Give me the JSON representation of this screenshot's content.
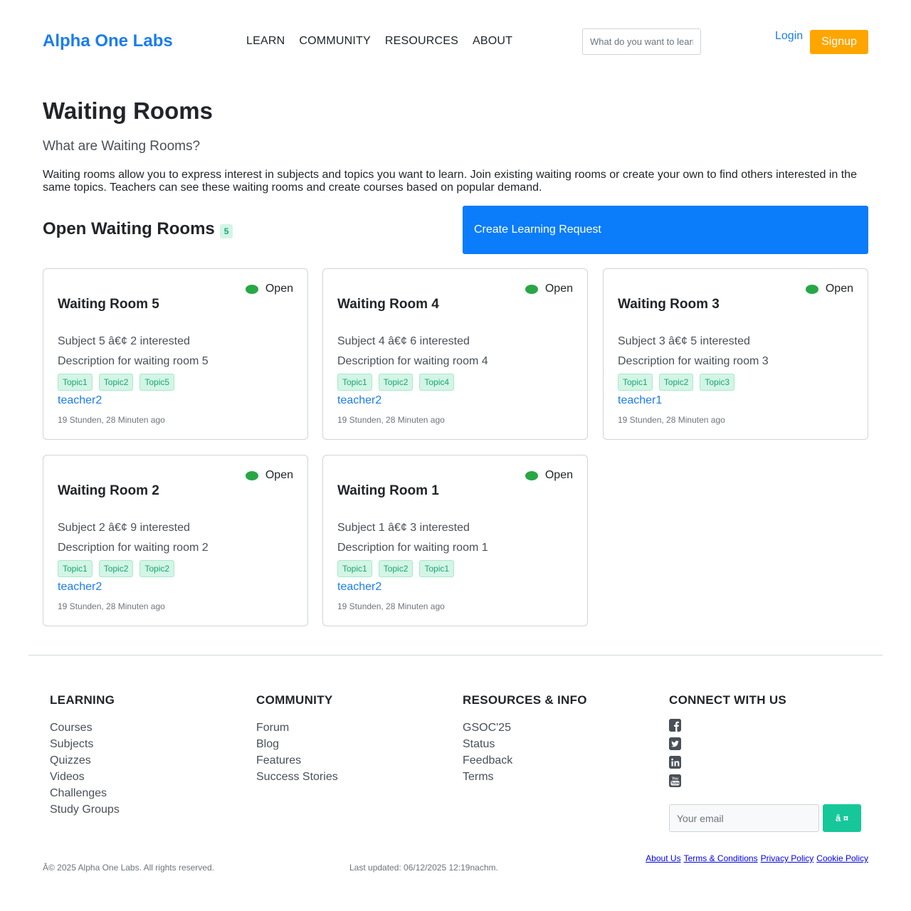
{
  "header": {
    "logo": "Alpha One Labs",
    "nav": [
      "LEARN",
      "COMMUNITY",
      "RESOURCES",
      "ABOUT"
    ],
    "search_placeholder": "What do you want to learn?",
    "login": "Login",
    "signup": "Signup"
  },
  "intro": {
    "title": "Waiting Rooms",
    "subtitle": "What are Waiting Rooms?",
    "text": "Waiting rooms allow you to express interest in subjects and topics you want to learn. Join existing waiting rooms or create your own to find others interested in the same topics. Teachers can see these waiting rooms and create courses based on popular demand."
  },
  "section": {
    "title": "Open Waiting Rooms",
    "count": "5",
    "create_button": "Create Learning Request"
  },
  "rooms": [
    {
      "status": "Open",
      "title": "Waiting Room 5",
      "subject": "Subject 5 â€¢ 2 interested",
      "description": "Description for waiting room 5",
      "tags": [
        "Topic1",
        "Topic2",
        "Topic5"
      ],
      "teacher": "teacher2",
      "time": "19 Stunden, 28 Minuten ago"
    },
    {
      "status": "Open",
      "title": "Waiting Room 4",
      "subject": "Subject 4 â€¢ 6 interested",
      "description": "Description for waiting room 4",
      "tags": [
        "Topic1",
        "Topic2",
        "Topic4"
      ],
      "teacher": "teacher2",
      "time": "19 Stunden, 28 Minuten ago"
    },
    {
      "status": "Open",
      "title": "Waiting Room 3",
      "subject": "Subject 3 â€¢ 5 interested",
      "description": "Description for waiting room 3",
      "tags": [
        "Topic1",
        "Topic2",
        "Topic3"
      ],
      "teacher": "teacher1",
      "time": "19 Stunden, 28 Minuten ago"
    },
    {
      "status": "Open",
      "title": "Waiting Room 2",
      "subject": "Subject 2 â€¢ 9 interested",
      "description": "Description for waiting room 2",
      "tags": [
        "Topic1",
        "Topic2",
        "Topic2"
      ],
      "teacher": "teacher2",
      "time": "19 Stunden, 28 Minuten ago"
    },
    {
      "status": "Open",
      "title": "Waiting Room 1",
      "subject": "Subject 1 â€¢ 3 interested",
      "description": "Description for waiting room 1",
      "tags": [
        "Topic1",
        "Topic2",
        "Topic1"
      ],
      "teacher": "teacher2",
      "time": "19 Stunden, 28 Minuten ago"
    }
  ],
  "footer": {
    "learning": {
      "heading": "LEARNING",
      "links": [
        "Courses",
        "Subjects",
        "Quizzes",
        "Videos",
        "Challenges",
        "Study Groups"
      ]
    },
    "community": {
      "heading": "COMMUNITY",
      "links": [
        "Forum",
        "Blog",
        "Features",
        "Success Stories"
      ]
    },
    "resources": {
      "heading": "RESOURCES & INFO",
      "links": [
        "GSOC'25",
        "Status",
        "Feedback",
        "Terms"
      ]
    },
    "connect": {
      "heading": "CONNECT WITH US",
      "social_icons": [
        "facebook-icon",
        "twitter-icon",
        "linkedin-icon",
        "youtube-icon"
      ],
      "email_placeholder": "Your email",
      "email_button": "â ¤"
    },
    "copyright": "Â© 2025 Alpha One Labs. All rights reserved.",
    "updated": "Last updated: 06/12/2025 12:19nachm.",
    "legal": [
      "About Us",
      "Terms & Conditions",
      "Privacy Policy",
      "Cookie Policy"
    ]
  },
  "colors": {
    "brand": "#1a7cf0",
    "signup": "#ffa500",
    "primary_button": "#0b7cfa",
    "open_status": "#28a745",
    "tag_text": "#16a673",
    "tag_bg": "#d3f5e6",
    "email_button": "#16c79a"
  }
}
